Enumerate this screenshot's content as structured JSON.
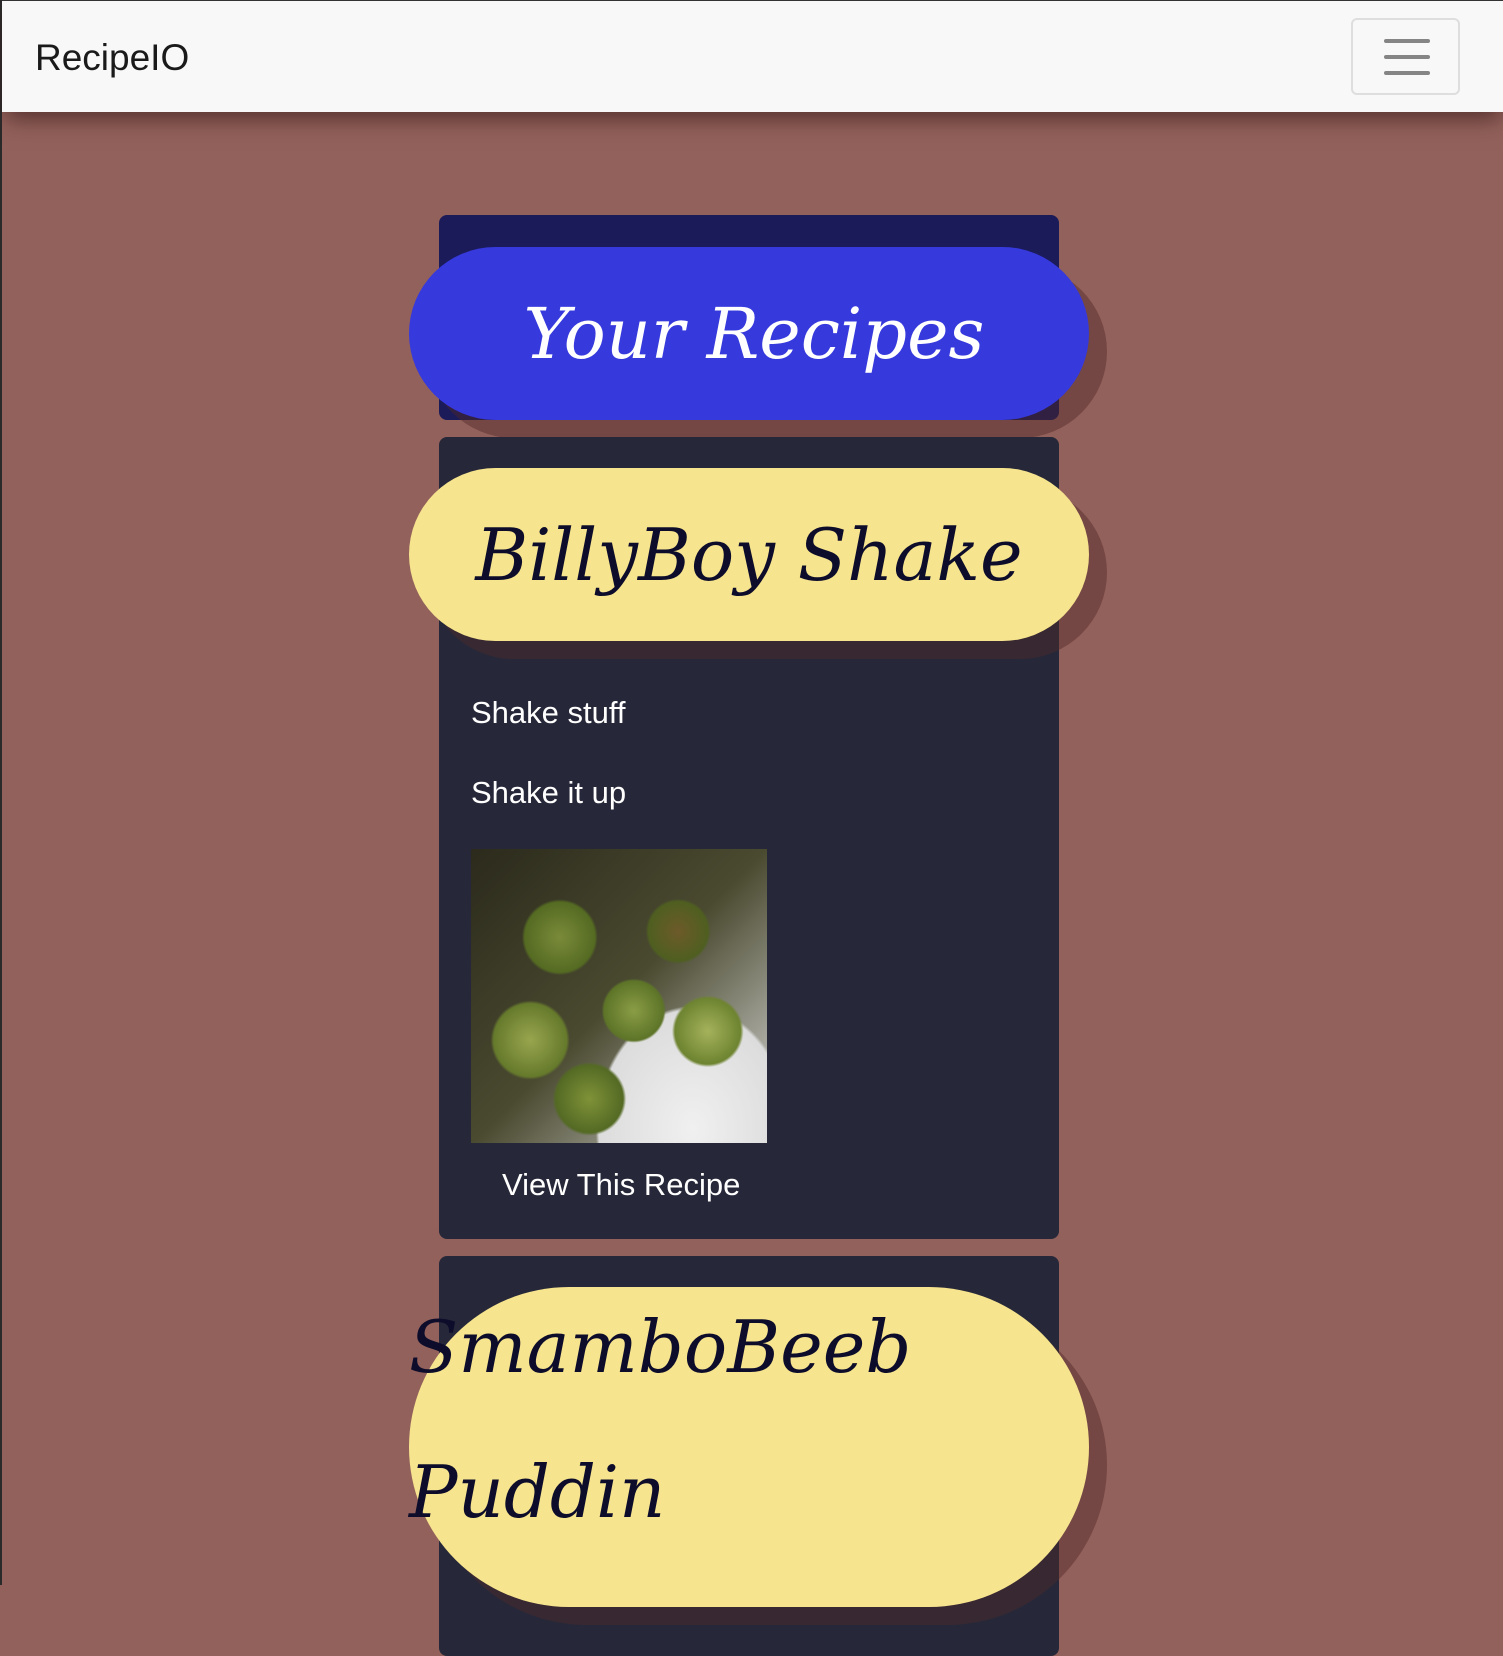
{
  "navbar": {
    "brand": "RecipeIO",
    "toggler_icon": "hamburger-menu-icon"
  },
  "header": {
    "title": "Your Recipes"
  },
  "recipes": [
    {
      "title": "BillyBoy Shake",
      "ingredients": "Shake stuff",
      "instructions": "Shake it up",
      "link_label": "View This Recipe"
    },
    {
      "title": "SmamboBeeb Puddin"
    }
  ],
  "colors": {
    "background": "#93615b",
    "navbar": "#f8f8f8",
    "header_card": "#1b1b59",
    "header_pill": "#3639dc",
    "recipe_card": "#262839",
    "recipe_pill": "#f7e48e",
    "recipe_title": "#0d0d2b"
  }
}
